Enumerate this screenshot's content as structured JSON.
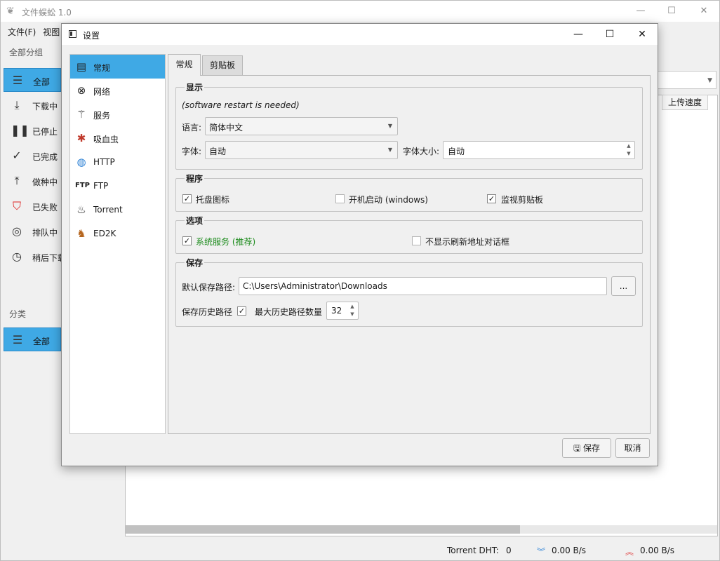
{
  "main": {
    "title": "文件蜈蚣 1.0",
    "menu": [
      "文件(F)",
      "视图"
    ],
    "group_label": "全部分组",
    "category_label": "分类",
    "sidebar": [
      {
        "label": "全部",
        "icon": "list-icon"
      },
      {
        "label": "下载中",
        "icon": "download-icon"
      },
      {
        "label": "已停止",
        "icon": "pause-icon"
      },
      {
        "label": "已完成",
        "icon": "check-icon"
      },
      {
        "label": "做种中",
        "icon": "upload-icon"
      },
      {
        "label": "已失败",
        "icon": "error-shield-icon"
      },
      {
        "label": "排队中",
        "icon": "compass-icon"
      },
      {
        "label": "稍后下载",
        "icon": "clock-icon"
      }
    ],
    "category_items": [
      {
        "label": "全部"
      }
    ],
    "column_header": "上传速度",
    "status": {
      "dht_label": "Torrent DHT:",
      "dht_value": "0",
      "down_speed": "0.00 B/s",
      "up_speed": "0.00 B/s"
    }
  },
  "dialog": {
    "title": "设置",
    "nav": [
      "常规",
      "网络",
      "服务",
      "吸血虫",
      "HTTP",
      "FTP",
      "Torrent",
      "ED2K"
    ],
    "tabs": [
      "常规",
      "剪贴板"
    ],
    "display": {
      "title": "显示",
      "note": "(software restart is needed)",
      "language_label": "语言:",
      "language_value": "简体中文",
      "font_label": "字体:",
      "font_value": "自动",
      "font_size_label": "字体大小:",
      "font_size_value": "自动"
    },
    "program": {
      "title": "程序",
      "tray_label": "托盘图标",
      "tray_checked": true,
      "autostart_label": "开机启动 (windows)",
      "autostart_checked": false,
      "clipboard_label": "监视剪贴板",
      "clipboard_checked": true
    },
    "options": {
      "title": "选项",
      "service_label": "系统服务 (推荐)",
      "service_checked": true,
      "no_refresh_label": "不显示刷新地址对话框",
      "no_refresh_checked": false
    },
    "save": {
      "title": "保存",
      "default_path_label": "默认保存路径:",
      "default_path_value": "C:\\Users\\Administrator\\Downloads",
      "browse_label": "...",
      "history_label": "保存历史路径",
      "history_checked": true,
      "max_history_label": "最大历史路径数量",
      "max_history_value": "32"
    },
    "buttons": {
      "save": "保存",
      "cancel": "取消"
    }
  },
  "colors": {
    "accent": "#3fa9e5",
    "recommend_green": "#1a8a1a"
  }
}
